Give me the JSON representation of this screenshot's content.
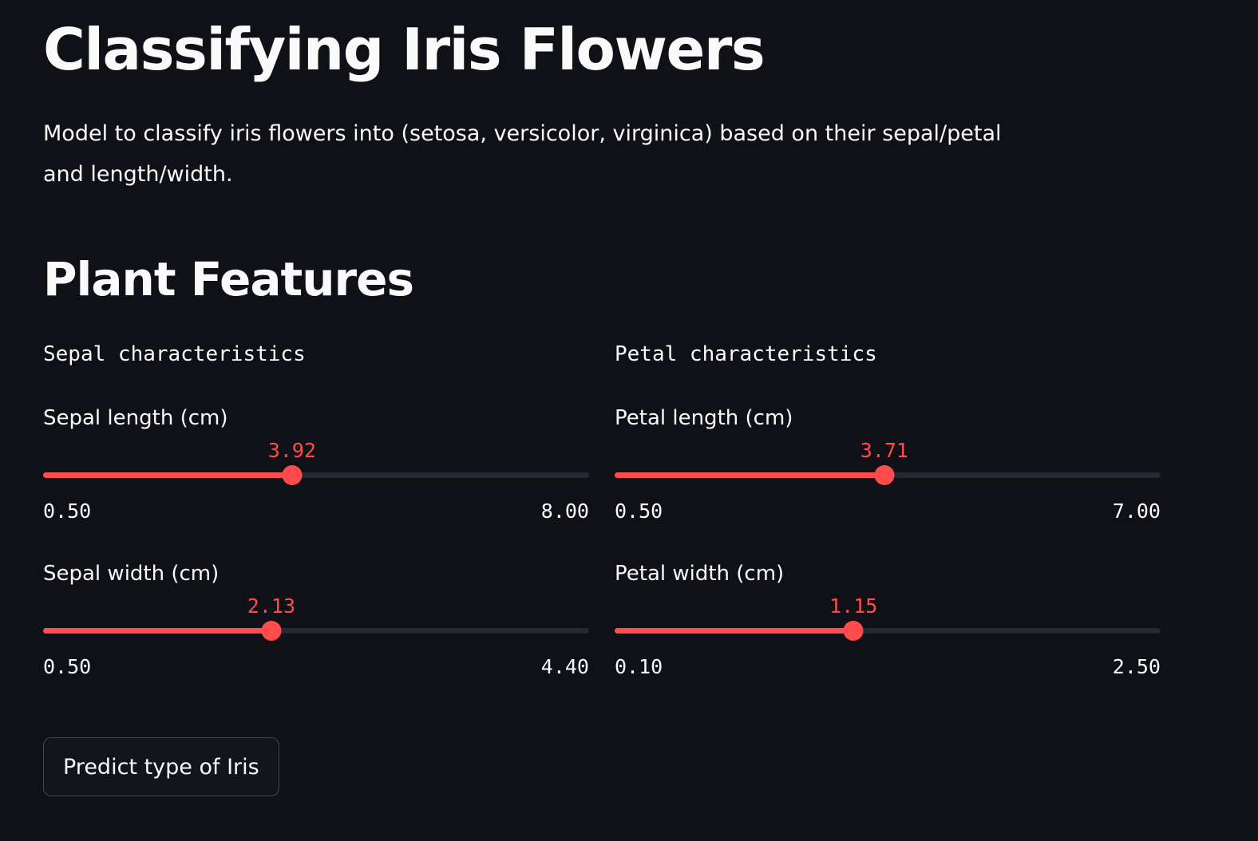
{
  "header": {
    "title": "Classifying Iris Flowers",
    "description": "Model to classify iris flowers into (setosa, versicolor, virginica) based on their sepal/petal and length/width."
  },
  "features": {
    "subheader": "Plant Features",
    "sepal": {
      "caption": "Sepal characteristics",
      "length": {
        "label": "Sepal length (cm)",
        "value": "3.92",
        "min": "0.50",
        "max": "8.00",
        "fraction": 0.456
      },
      "width": {
        "label": "Sepal width (cm)",
        "value": "2.13",
        "min": "0.50",
        "max": "4.40",
        "fraction": 0.418
      }
    },
    "petal": {
      "caption": "Petal characteristics",
      "length": {
        "label": "Petal length (cm)",
        "value": "3.71",
        "min": "0.50",
        "max": "7.00",
        "fraction": 0.494
      },
      "width": {
        "label": "Petal width (cm)",
        "value": "1.15",
        "min": "0.10",
        "max": "2.50",
        "fraction": 0.4375
      }
    }
  },
  "actions": {
    "predict_label": "Predict type of Iris"
  },
  "colors": {
    "background": "#0f1117",
    "accent": "#ff4b4b",
    "track": "#262730",
    "text": "#fafafa"
  }
}
